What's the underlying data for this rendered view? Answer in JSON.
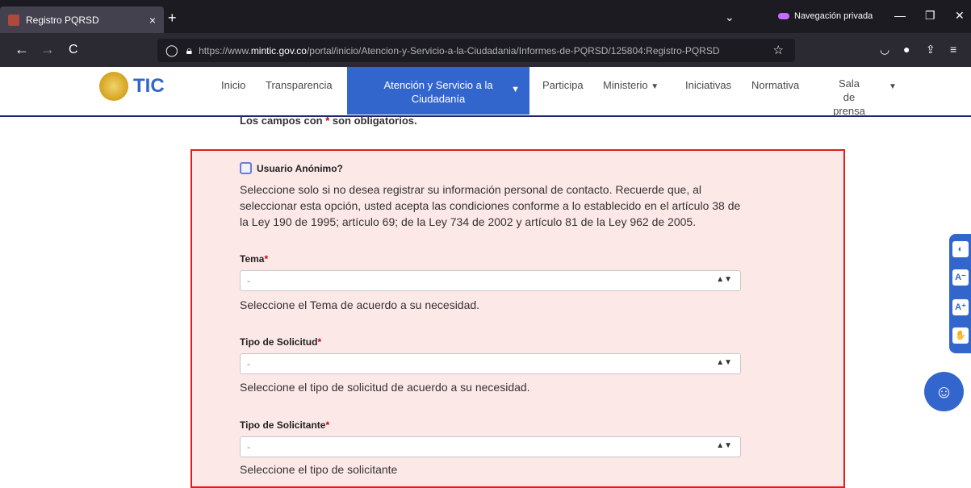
{
  "browser": {
    "tab_title": "Registro PQRSD",
    "tab_close": "×",
    "new_tab": "+",
    "tabs_list": "⌄",
    "private_label": "Navegación privada",
    "win_min": "—",
    "win_max": "❐",
    "win_close": "✕",
    "back": "←",
    "forward": "→",
    "reload": "C",
    "url_prefix": "https://www.",
    "url_domain": "mintic.gov.co",
    "url_path": "/portal/inicio/Atencion-y-Servicio-a-la-Ciudadania/Informes-de-PQRSD/125804:Registro-PQRSD",
    "icons": [
      "shield-icon",
      "lock-icon",
      "star-icon",
      "pocket-icon",
      "account-icon",
      "share-icon",
      "menu-icon"
    ]
  },
  "site": {
    "logo_text": "TIC",
    "menu": {
      "inicio": "Inicio",
      "transparencia": "Transparencia",
      "atencion": "Atención y Servicio a la Ciudadanía",
      "participa": "Participa",
      "ministerio": "Ministerio",
      "iniciativas": "Iniciativas",
      "normativa": "Normativa",
      "sala_prensa": "Sala de prensa"
    },
    "accent_color": "#3366cc",
    "header_rule_color": "#1c2a6b"
  },
  "form": {
    "required_note_pre": "Los campos con ",
    "required_note_ast": "*",
    "required_note_post": " son obligatorios.",
    "anon_label": "Usuario Anónimo?",
    "anon_desc": "Seleccione solo si no desea registrar su información personal de contacto. Recuerde que, al seleccionar esta opción, usted acepta las condiciones conforme a lo establecido en el artículo 38 de la Ley 190 de 1995; artículo 69; de la Ley 734 de 2002 y artículo 81 de la Ley 962 de 2005.",
    "fields": [
      {
        "label": "Tema",
        "ast": "*",
        "value": "-",
        "help": "Seleccione el Tema de acuerdo a su necesidad."
      },
      {
        "label": "Tipo de Solicitud",
        "ast": "*",
        "value": "-",
        "help": "Seleccione el tipo de solicitud de acuerdo a su necesidad."
      },
      {
        "label": "Tipo de Solicitante",
        "ast": "*",
        "value": "-",
        "help": "Seleccione el tipo de solicitante"
      }
    ],
    "panel_border_color": "#e01d1d",
    "panel_bg_color": "#fde8e8"
  },
  "accessibility": {
    "contrast": "◐",
    "font_smaller": "A⁻",
    "font_larger": "A⁺",
    "sign_language": "✋",
    "help_button": "☺"
  }
}
